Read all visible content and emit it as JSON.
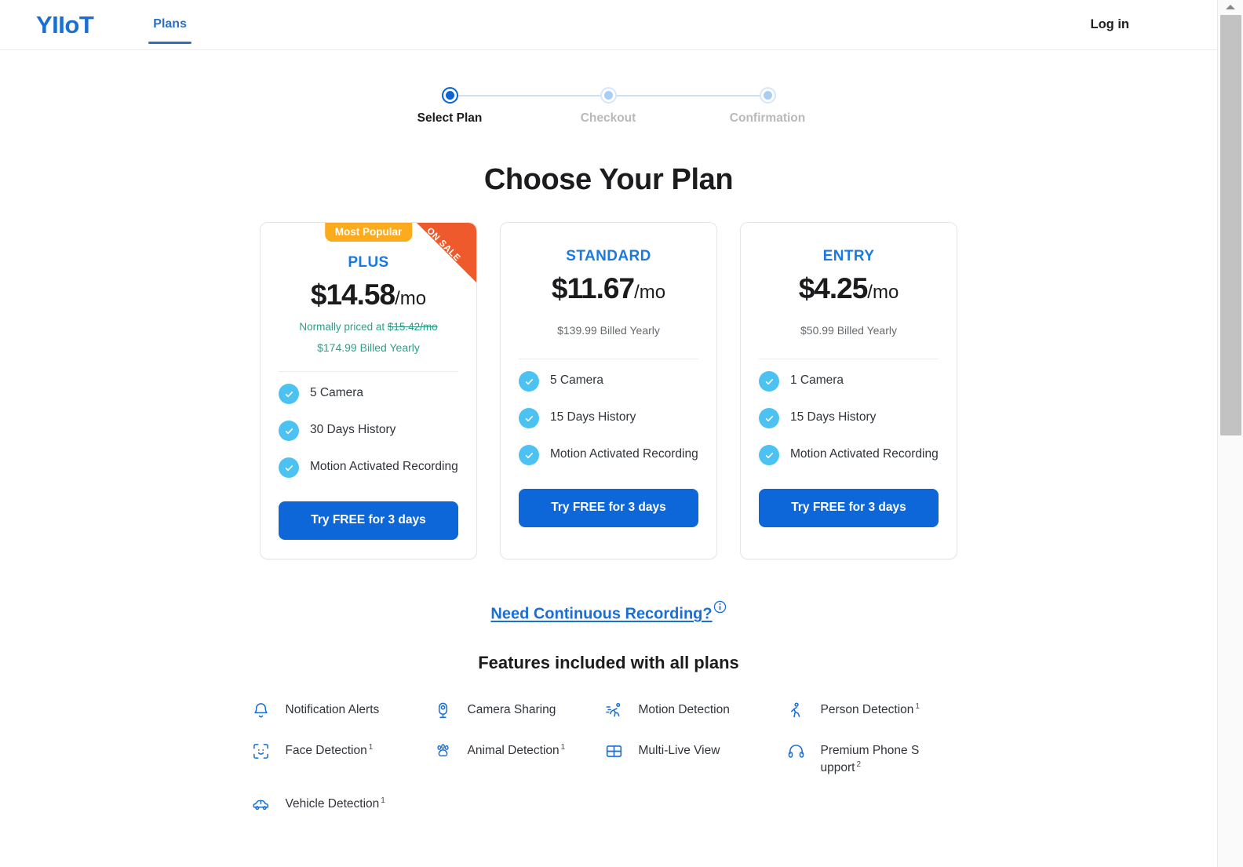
{
  "header": {
    "logo": "YIIoT",
    "nav": [
      {
        "label": "Plans",
        "active": true
      }
    ],
    "login_label": "Log in"
  },
  "stepper": {
    "steps": [
      {
        "label": "Select Plan",
        "state": "active"
      },
      {
        "label": "Checkout",
        "state": "inactive"
      },
      {
        "label": "Confirmation",
        "state": "inactive"
      }
    ]
  },
  "main": {
    "title": "Choose Your Plan",
    "plans": [
      {
        "name": "PLUS",
        "badge": "Most Popular",
        "ribbon": "ON SALE",
        "price": "$14.58",
        "price_suffix": "/mo",
        "sale_prefix": "Normally priced at ",
        "sale_struck": "$15.42/mo",
        "billed": "$174.99 Billed Yearly",
        "features": [
          "5 Camera",
          "30 Days History",
          "Motion Activated Recording"
        ],
        "cta": "Try FREE for 3 days"
      },
      {
        "name": "STANDARD",
        "price": "$11.67",
        "price_suffix": "/mo",
        "billed": "$139.99 Billed Yearly",
        "features": [
          "5 Camera",
          "15 Days History",
          "Motion Activated Recording"
        ],
        "cta": "Try FREE for 3 days"
      },
      {
        "name": "ENTRY",
        "price": "$4.25",
        "price_suffix": "/mo",
        "billed": "$50.99 Billed Yearly",
        "features": [
          "1 Camera",
          "15 Days History",
          "Motion Activated Recording"
        ],
        "cta": "Try FREE for 3 days"
      }
    ],
    "continuous_recording_link": "Need Continuous Recording?",
    "features_section": {
      "title": "Features included with all plans",
      "items": [
        {
          "icon": "bell-icon",
          "label": "Notification Alerts",
          "footnote": ""
        },
        {
          "icon": "camera-icon",
          "label": "Camera Sharing",
          "footnote": ""
        },
        {
          "icon": "motion-icon",
          "label": "Motion Detection",
          "footnote": ""
        },
        {
          "icon": "person-icon",
          "label": "Person Detection",
          "footnote": "1"
        },
        {
          "icon": "face-icon",
          "label": "Face Detection",
          "footnote": "1"
        },
        {
          "icon": "paw-icon",
          "label": "Animal Detection",
          "footnote": "1"
        },
        {
          "icon": "grid-icon",
          "label": "Multi-Live View",
          "footnote": ""
        },
        {
          "icon": "headset-icon",
          "label": "Premium Phone S upport",
          "footnote": "2"
        },
        {
          "icon": "car-icon",
          "label": "Vehicle Detection",
          "footnote": "1"
        }
      ]
    }
  },
  "colors": {
    "brand_blue": "#1a6fd4",
    "cta_blue": "#0d67d8",
    "badge_amber": "#fbab1c",
    "ribbon_orange": "#ee5a2b",
    "check_sky": "#4cc2f2",
    "sale_green": "#2e9e88"
  }
}
